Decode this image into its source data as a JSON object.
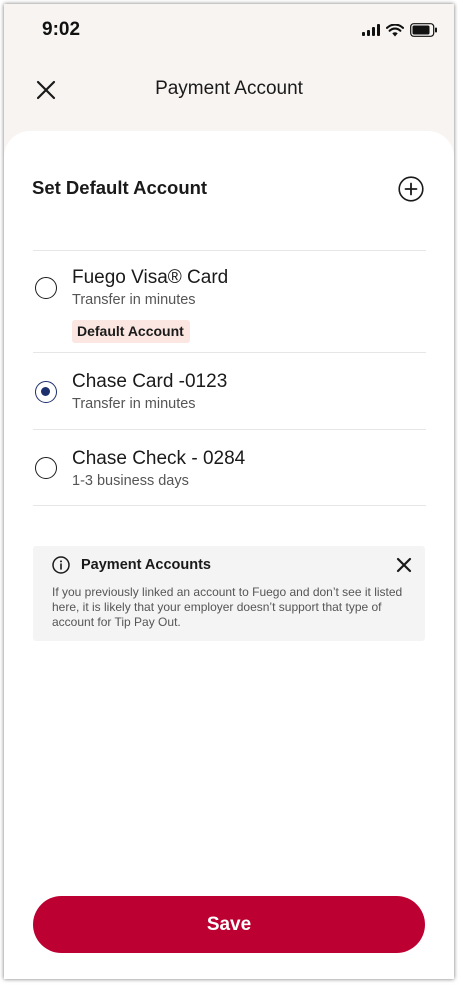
{
  "status_bar": {
    "time": "9:02"
  },
  "header": {
    "title": "Payment Account",
    "close_icon": "close-icon"
  },
  "section": {
    "title": "Set Default Account",
    "add_icon": "plus-circle-icon"
  },
  "accounts": [
    {
      "name": "Fuego Visa® Card",
      "subtitle": "Transfer in minutes",
      "badge": "Default Account",
      "selected": false
    },
    {
      "name": "Chase Card -0123",
      "subtitle": "Transfer in minutes",
      "selected": true
    },
    {
      "name": "Chase Check - 0284",
      "subtitle": "1-3 business days",
      "selected": false
    }
  ],
  "info_card": {
    "icon": "info-icon",
    "title": "Payment Accounts",
    "text": "If you previously linked an account to Fuego and don’t see it listed here, it is likely that your employer doesn’t support that type of account for Tip Pay Out."
  },
  "save_button": {
    "label": "Save"
  },
  "colors": {
    "brand": "#bd0032",
    "radio_selected": "#1e2f6e",
    "badge_bg": "#fbe6e1",
    "header_bg": "#f8f4f2"
  }
}
